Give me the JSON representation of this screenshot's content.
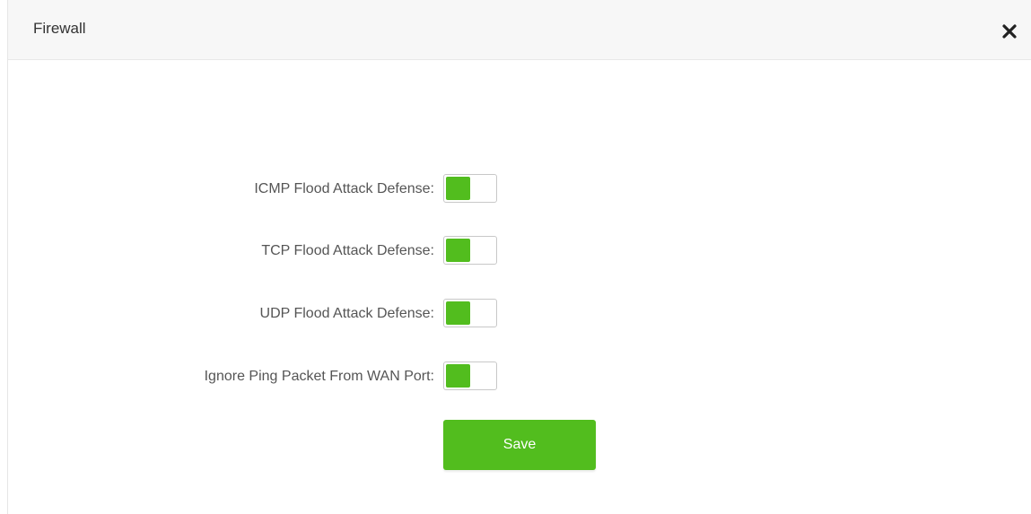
{
  "dialog": {
    "title": "Firewall",
    "close_icon": "close-icon"
  },
  "settings": [
    {
      "label": "ICMP Flood Attack Defense:",
      "enabled": true
    },
    {
      "label": "TCP Flood Attack Defense:",
      "enabled": true
    },
    {
      "label": "UDP Flood Attack Defense:",
      "enabled": true
    },
    {
      "label": "Ignore Ping Packet From WAN Port:",
      "enabled": true
    }
  ],
  "save_label": "Save",
  "colors": {
    "accent": "#52bd1e",
    "header_bg": "#f7f7f7",
    "label_text": "#555555"
  }
}
